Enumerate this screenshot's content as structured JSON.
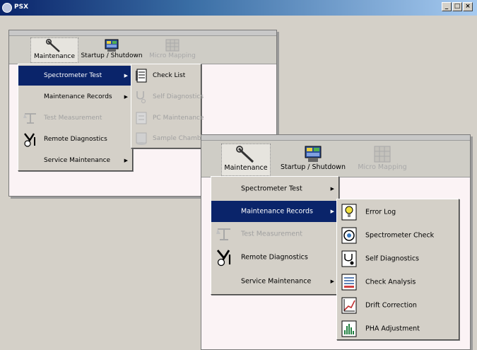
{
  "app": {
    "title": "PSX"
  },
  "window_controls": {
    "minimize": "_",
    "maximize": "□",
    "close": "×"
  },
  "toolbar": {
    "maintenance": "Maintenance",
    "startup_shutdown": "Startup / Shutdown",
    "micro_mapping": "Micro Mapping"
  },
  "main_menu": {
    "spectrometer_test": "Spectrometer Test",
    "maintenance_records": "Maintenance Records",
    "test_measurement": "Test Measurement",
    "remote_diagnostics": "Remote Diagnostics",
    "service_maintenance": "Service Maintenance"
  },
  "spectrometer_submenu": {
    "check_list": "Check List",
    "self_diagnostics": "Self Diagnostics",
    "pc_maintenance": "PC Maintenance",
    "sample_chamber": "Sample Chamb..."
  },
  "records_submenu": {
    "error_log": "Error Log",
    "spectrometer_check": "Spectrometer Check",
    "self_diagnostics": "Self Diagnostics",
    "check_analysis": "Check Analysis",
    "drift_correction": "Drift Correction",
    "pha_adjustment": "PHA Adjustment"
  },
  "colors": {
    "selection": "#0a246a",
    "menu_bg": "#d4d0c8",
    "window_bg": "#fbf3f5",
    "title_start": "#0a246a",
    "disabled": "#a0a0a0"
  }
}
